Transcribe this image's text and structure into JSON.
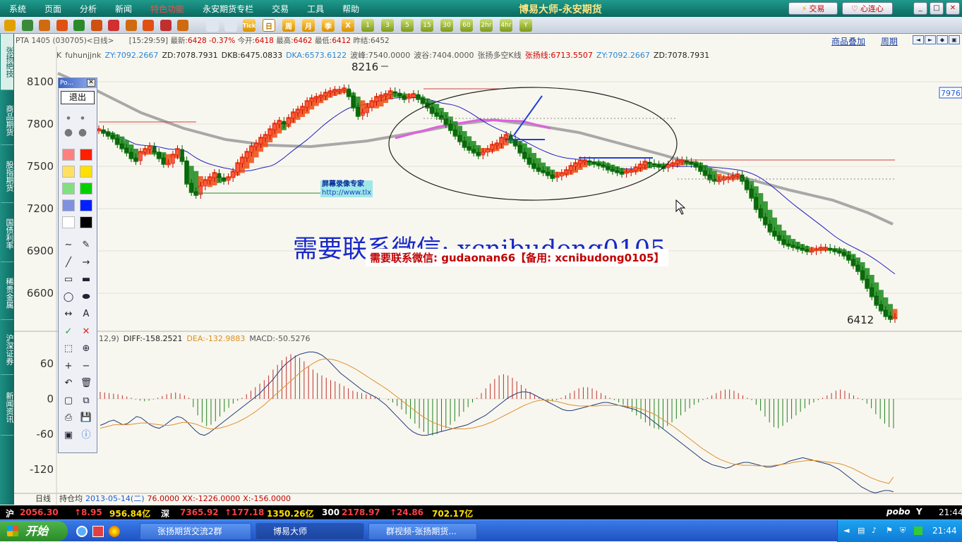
{
  "menu": {
    "items": [
      "系统",
      "页面",
      "分析",
      "新闻",
      "特色功能",
      "永安期货专栏",
      "交易",
      "工具",
      "帮助"
    ],
    "hot_index": 4
  },
  "app_title": "博易大师-永安期货",
  "top_buttons": {
    "trade": "交易",
    "connect": "心连心"
  },
  "toolbar": {
    "periods": [
      "日",
      "周",
      "月",
      "季",
      "X"
    ],
    "active_period": "日",
    "numbers": [
      "1",
      "3",
      "5",
      "15",
      "30",
      "60",
      "2hr",
      "4hr",
      "Y"
    ],
    "tick": "Tick"
  },
  "side_tabs": [
    "张扬绝技",
    "商品期货",
    "股指期货",
    "国债利率",
    "稀贵金属",
    "沪深证券",
    "新闻资讯"
  ],
  "info_line": {
    "symbol": "PTA 1405 (030705)<日线>",
    "time": "[15:29:59]",
    "latest_label": "最新:",
    "latest": "6428",
    "change": "-0.37%",
    "open_label": "今开:",
    "open": "6418",
    "high_label": "最高:",
    "high": "6462",
    "low_label": "最低:",
    "low": "6412",
    "prev_label": "昨结:",
    "prev": "6452"
  },
  "right_links": [
    "商品叠加",
    "周期"
  ],
  "indicator_line": [
    {
      "t": "K",
      "c": "#555555"
    },
    {
      "t": "fuhunjjnk",
      "c": "#555555"
    },
    {
      "t": "ZY:7092.2667",
      "c": "#2a86d8"
    },
    {
      "t": "ZD:7078.7931",
      "c": "#222222"
    },
    {
      "t": "DKB:6475.0833",
      "c": "#222222"
    },
    {
      "t": "DKA:6573.6122",
      "c": "#2a86d8"
    },
    {
      "t": "波峰:7540.0000",
      "c": "#555555"
    },
    {
      "t": "波谷:7404.0000",
      "c": "#555555"
    },
    {
      "t": "张扬多空K线",
      "c": "#555555"
    },
    {
      "t": "张扬线:6713.5507",
      "c": "#d00000"
    },
    {
      "t": "ZY:7092.2667",
      "c": "#2a86d8"
    },
    {
      "t": "ZD:7078.7931",
      "c": "#222222"
    }
  ],
  "macd_line": [
    {
      "t": "12,9)",
      "c": "#555555"
    },
    {
      "t": "DIFF:-158.2521",
      "c": "#222222"
    },
    {
      "t": "DEA:-132.9883",
      "c": "#d89020"
    },
    {
      "t": "MACD:-50.5276",
      "c": "#555555"
    }
  ],
  "bottom_line": {
    "label": "日线",
    "hold": "持仓均",
    "date": "2013-05-14(二)",
    "v1": "76.0000",
    "xx": "XX:-1226.0000",
    "x": "X:-156.0000"
  },
  "palette": {
    "title": "Po...",
    "exit": "退出",
    "colors": [
      "#ff8080",
      "#ff2000",
      "#ffe060",
      "#ffe000",
      "#80e080",
      "#00d000",
      "#8090e0",
      "#0020ff",
      "#ffffff",
      "#000000"
    ]
  },
  "overlay": {
    "wechat": "需要联系微信: xcnibudong0105",
    "banner": "需要联系微信: gudaonan66【备用: xcnibudong0105】",
    "recorder_title": "屏幕录像专家",
    "recorder_url": "http://www.tlx"
  },
  "chart_data": [
    {
      "type": "candlestick",
      "title": "PTA 1405 (030705)<日线>",
      "y_ticks": [
        8100,
        7800,
        7500,
        7200,
        6900,
        6600
      ],
      "ylim": [
        6300,
        8300
      ],
      "max_label": "8216",
      "min_label": "6412",
      "right_label": "7976",
      "x_range": [
        0,
        180
      ],
      "close": [
        7760,
        7740,
        7720,
        7700,
        7660,
        7630,
        7600,
        7560,
        7540,
        7600,
        7620,
        7640,
        7600,
        7560,
        7520,
        7520,
        7580,
        7620,
        7540,
        7380,
        7320,
        7300,
        7360,
        7400,
        7420,
        7450,
        7420,
        7400,
        7420,
        7460,
        7520,
        7560,
        7600,
        7640,
        7660,
        7700,
        7720,
        7760,
        7800,
        7820,
        7800,
        7840,
        7880,
        7900,
        7920,
        7960,
        7980,
        7990,
        8000,
        8020,
        8030,
        8040,
        8040,
        8050,
        8000,
        7920,
        7860,
        7880,
        7920,
        7960,
        7990,
        8000,
        8010,
        8030,
        8020,
        8000,
        7980,
        7990,
        8010,
        7980,
        7950,
        7920,
        7880,
        7860,
        7840,
        7800,
        7760,
        7720,
        7680,
        7640,
        7620,
        7600,
        7580,
        7600,
        7620,
        7650,
        7660,
        7700,
        7720,
        7690,
        7650,
        7600,
        7560,
        7520,
        7490,
        7470,
        7460,
        7440,
        7420,
        7430,
        7450,
        7470,
        7500,
        7520,
        7540,
        7540,
        7530,
        7520,
        7510,
        7500,
        7480,
        7470,
        7460,
        7450,
        7460,
        7470,
        7490,
        7510,
        7530,
        7520,
        7510,
        7500,
        7490,
        7510,
        7520,
        7540,
        7540,
        7530,
        7520,
        7500,
        7470,
        7440,
        7410,
        7400,
        7400,
        7410,
        7420,
        7430,
        7440,
        7400,
        7340,
        7280,
        7200,
        7140,
        7090,
        7040,
        7010,
        6980,
        6950,
        6940,
        6930,
        6920,
        6910,
        6900,
        6900,
        6910,
        6920,
        6920,
        6910,
        6900,
        6890,
        6870,
        6840,
        6800,
        6760,
        6700,
        6640,
        6580,
        6520,
        6480,
        6440,
        6420,
        6428
      ]
    },
    {
      "type": "bar",
      "title": "MACD",
      "y_ticks": [
        60,
        0,
        -60,
        -120
      ],
      "ylim": [
        -160,
        100
      ],
      "macd": [
        12,
        11,
        10,
        9,
        8,
        6,
        4,
        2,
        -1,
        -3,
        -4,
        -3,
        -1,
        2,
        5,
        8,
        10,
        11,
        9,
        6,
        2,
        -14,
        -28,
        -40,
        -46,
        -44,
        -38,
        -30,
        -22,
        -15,
        -8,
        -3,
        2,
        8,
        14,
        20,
        26,
        32,
        40,
        50,
        58,
        66,
        72,
        76,
        74,
        70,
        64,
        56,
        50,
        44,
        40,
        36,
        32,
        30,
        26,
        22,
        18,
        14,
        12,
        10,
        8,
        6,
        4,
        2,
        0,
        -2,
        -6,
        -12,
        -18,
        -26,
        -34,
        -42,
        -50,
        -56,
        -60,
        -62,
        -60,
        -56,
        -50,
        -44,
        -38,
        -30,
        -22,
        -14,
        -6,
        2,
        10,
        18,
        26,
        34,
        40,
        42,
        40,
        36,
        30,
        24,
        18,
        12,
        6,
        2,
        -2,
        -4,
        -4,
        -2,
        2,
        6,
        10,
        14,
        18,
        20,
        20,
        18,
        14,
        10,
        6,
        2,
        -2,
        -6,
        -10,
        -16,
        -22,
        -28,
        -34,
        -40,
        -46,
        -50,
        -52,
        -50,
        -46,
        -40,
        -34,
        -28,
        -22,
        -16,
        -10,
        -6,
        -2,
        2,
        6,
        10,
        14,
        16,
        16,
        14,
        10,
        6,
        2,
        -2,
        -10,
        -20,
        -30,
        -40,
        -48,
        -50,
        -46,
        -40,
        -34,
        -28,
        -22,
        -16,
        -10,
        -6,
        -2,
        2,
        6,
        10,
        14,
        16,
        14,
        10,
        6,
        2,
        -2,
        -8,
        -16,
        -26,
        -34,
        -42,
        -48,
        -50
      ],
      "diff": [
        -45,
        -42,
        -38,
        -36,
        -40,
        -44,
        -42,
        -36,
        -30,
        -32,
        -38,
        -44,
        -48,
        -50,
        -46,
        -40,
        -34,
        -30,
        -32,
        -38,
        -46,
        -54,
        -60,
        -62,
        -58,
        -52,
        -46,
        -40,
        -34,
        -28,
        -22,
        -16,
        -10,
        -4,
        2,
        8,
        16,
        24,
        32,
        42,
        52,
        60,
        66,
        72,
        76,
        78,
        80,
        80,
        78,
        74,
        68,
        60,
        52,
        44,
        38,
        32,
        26,
        20,
        14,
        10,
        6,
        2,
        -4,
        -10,
        -18,
        -26,
        -34,
        -42,
        -50,
        -56,
        -60,
        -62,
        -62,
        -60,
        -58,
        -56,
        -54,
        -52,
        -50,
        -48,
        -46,
        -44,
        -40,
        -36,
        -32,
        -28,
        -22,
        -16,
        -10,
        -4,
        2,
        6,
        10,
        12,
        12,
        10,
        6,
        2,
        -2,
        -6,
        -10,
        -14,
        -18,
        -20,
        -20,
        -18,
        -16,
        -14,
        -12,
        -10,
        -8,
        -6,
        -6,
        -8,
        -10,
        -12,
        -14,
        -16,
        -18,
        -22,
        -26,
        -32,
        -38,
        -44,
        -50,
        -56,
        -62,
        -68,
        -74,
        -80,
        -86,
        -92,
        -98,
        -104,
        -108,
        -112,
        -114,
        -116,
        -118,
        -116,
        -112,
        -110,
        -108,
        -108,
        -110,
        -112,
        -114,
        -116,
        -116,
        -114,
        -112,
        -110,
        -106,
        -104,
        -102,
        -100,
        -102,
        -104,
        -106,
        -108,
        -110,
        -112,
        -116,
        -120,
        -126,
        -132,
        -138,
        -144,
        -150,
        -154,
        -158,
        -160,
        -158,
        -156,
        -156,
        -158
      ],
      "dea": [
        -50,
        -48,
        -46,
        -44,
        -44,
        -44,
        -44,
        -43,
        -42,
        -41,
        -41,
        -42,
        -43,
        -44,
        -45,
        -45,
        -44,
        -42,
        -40,
        -40,
        -41,
        -43,
        -46,
        -49,
        -51,
        -51,
        -50,
        -48,
        -46,
        -43,
        -40,
        -36,
        -32,
        -27,
        -22,
        -16,
        -10,
        -3,
        4,
        11,
        18,
        25,
        32,
        39,
        46,
        52,
        57,
        62,
        66,
        68,
        68,
        67,
        65,
        62,
        59,
        55,
        51,
        46,
        41,
        36,
        31,
        26,
        21,
        16,
        10,
        4,
        -2,
        -8,
        -14,
        -20,
        -26,
        -31,
        -36,
        -40,
        -43,
        -46,
        -48,
        -50,
        -51,
        -51,
        -51,
        -50,
        -49,
        -47,
        -45,
        -42,
        -39,
        -35,
        -31,
        -27,
        -23,
        -19,
        -15,
        -11,
        -8,
        -5,
        -3,
        -2,
        -2,
        -3,
        -4,
        -6,
        -8,
        -10,
        -11,
        -12,
        -12,
        -12,
        -12,
        -12,
        -11,
        -11,
        -11,
        -11,
        -11,
        -12,
        -13,
        -14,
        -16,
        -18,
        -21,
        -24,
        -28,
        -33,
        -38,
        -43,
        -48,
        -54,
        -60,
        -66,
        -72,
        -78,
        -84,
        -89,
        -94,
        -99,
        -103,
        -106,
        -109,
        -111,
        -112,
        -113,
        -113,
        -113,
        -114,
        -114,
        -114,
        -114,
        -113,
        -112,
        -111,
        -110,
        -108,
        -107,
        -106,
        -105,
        -105,
        -105,
        -106,
        -107,
        -108,
        -109,
        -110,
        -112,
        -115,
        -118,
        -122,
        -126,
        -130,
        -134,
        -137,
        -140,
        -142,
        -144,
        -133
      ]
    }
  ],
  "status": {
    "sh_label": "沪",
    "sh": "2056.30",
    "sh_chg": "↑8.95",
    "sh_amt": "956.84亿",
    "sz_label": "深",
    "sz": "7365.92",
    "sz_chg": "↑177.18",
    "sz_amt": "1350.26亿",
    "i300_label": "300",
    "i300": "2178.97",
    "i300_chg": "↑24.86",
    "i300_amt": "702.17亿",
    "brand": "pobo",
    "time": "21:44"
  },
  "taskbar": {
    "start": "开始",
    "tasks": [
      "张扬期货交流2群",
      "博易大师",
      "群视频-张扬期货..."
    ],
    "clock": "21:44"
  }
}
